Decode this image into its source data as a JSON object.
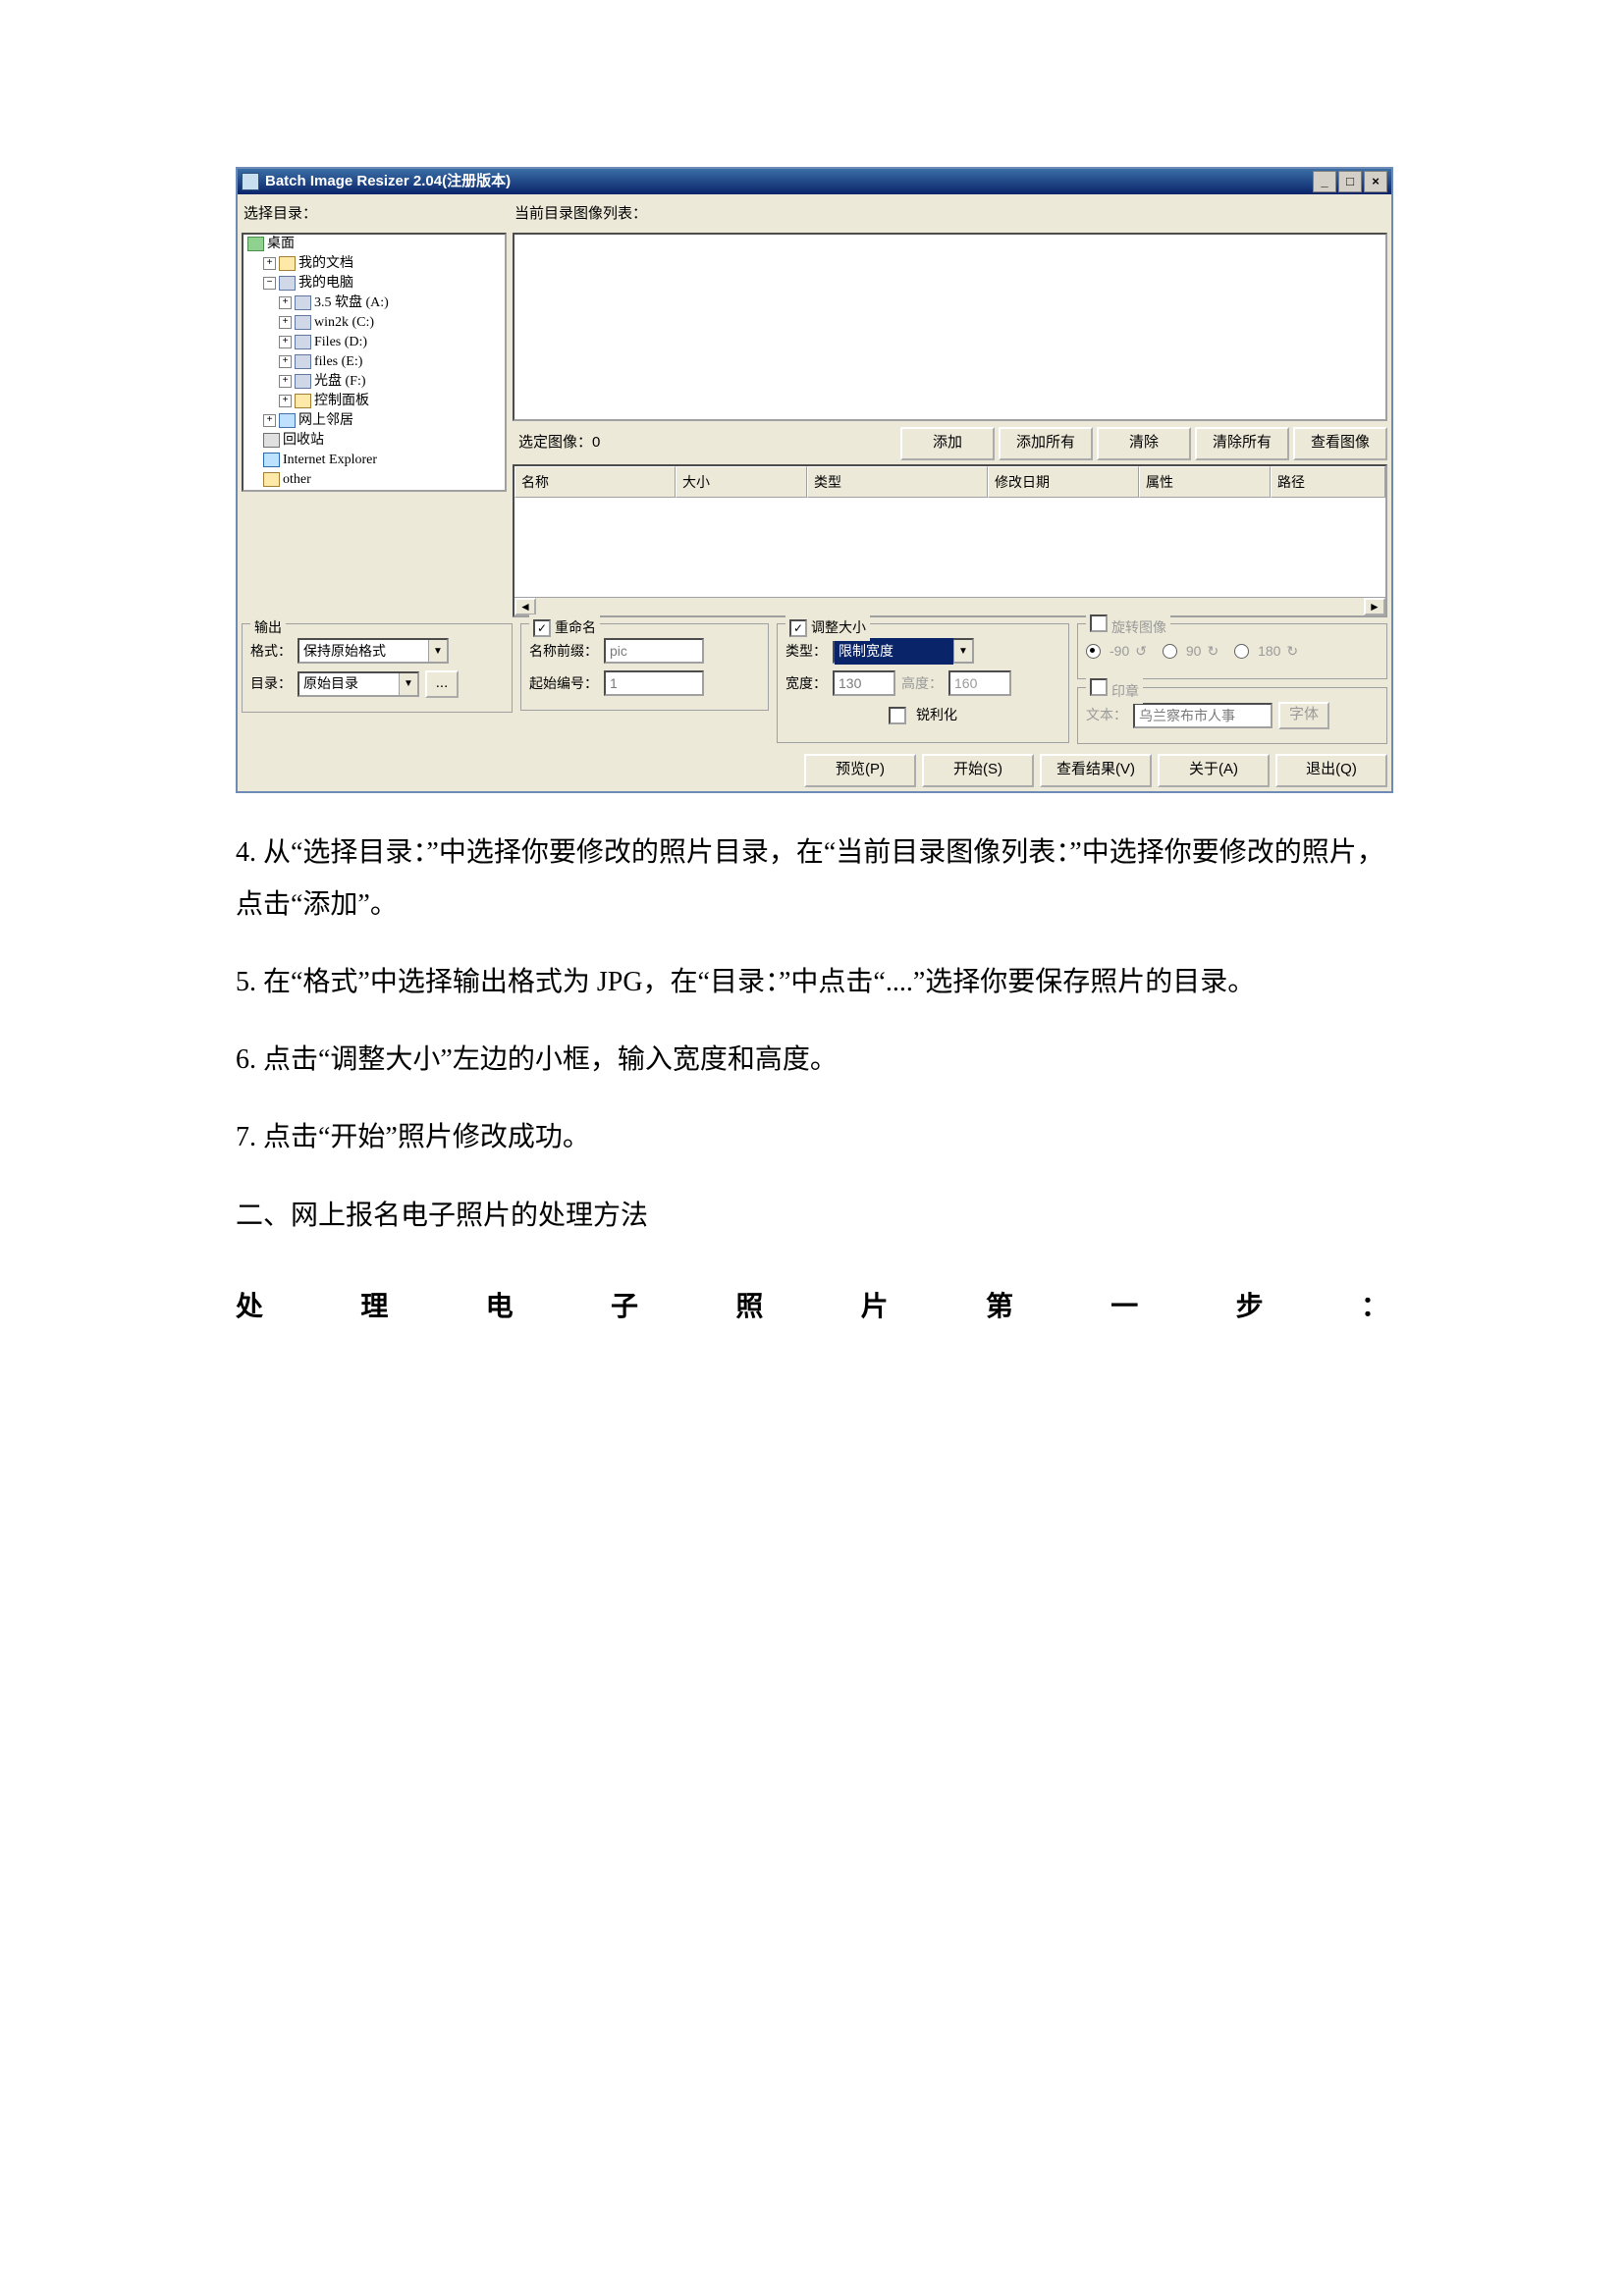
{
  "window": {
    "title": "Batch Image Resizer 2.04(注册版本)",
    "min": "_",
    "max": "□",
    "close": "×"
  },
  "labels": {
    "select_dir": "选择目录：",
    "image_list": "当前目录图像列表：",
    "selected_count": "选定图像：0"
  },
  "tree": {
    "desktop": "桌面",
    "mydocs": "我的文档",
    "mycomputer": "我的电脑",
    "a": "3.5 软盘 (A:)",
    "c": "win2k (C:)",
    "d": "Files (D:)",
    "e": "files (E:)",
    "f": "光盘 (F:)",
    "ctrl": "控制面板",
    "net": "网上邻居",
    "bin": "回收站",
    "ie": "Internet Explorer",
    "other": "other"
  },
  "buttons": {
    "add": "添加",
    "add_all": "添加所有",
    "remove": "清除",
    "remove_all": "清除所有",
    "view": "查看图像",
    "preview": "预览(P)",
    "start": "开始(S)",
    "results": "查看结果(V)",
    "about": "关于(A)",
    "quit": "退出(Q)",
    "browse": "...",
    "font": "字体"
  },
  "columns": {
    "name": "名称",
    "size": "大小",
    "type": "类型",
    "date": "修改日期",
    "attr": "属性",
    "path": "路径"
  },
  "output": {
    "group": "输出",
    "format_label": "格式：",
    "format_value": "保持原始格式",
    "dir_label": "目录：",
    "dir_value": "原始目录"
  },
  "rename": {
    "chk": "重命名",
    "prefix_label": "名称前缀：",
    "prefix_value": "pic",
    "start_label": "起始编号：",
    "start_value": "1"
  },
  "resize": {
    "chk": "调整大小",
    "type_label": "类型：",
    "type_value": "限制宽度",
    "w_label": "宽度：",
    "w_value": "130",
    "h_label": "高度：",
    "h_value": "160",
    "sharpen": "锐利化"
  },
  "rotate": {
    "chk": "旋转图像",
    "m90": "-90",
    "p90": "90",
    "p180": "180"
  },
  "stamp": {
    "chk": "印章",
    "text_label": "文本：",
    "text_value": "乌兰察布市人事"
  },
  "doc": {
    "p4": "4. 从“选择目录：”中选择你要修改的照片目录，在“当前目录图像列表：”中选择你要修改的照片，点击“添加”。",
    "p5": "5. 在“格式”中选择输出格式为 JPG，在“目录：”中点击“....”选择你要保存照片的目录。",
    "p6": "6. 点击“调整大小”左边的小框，输入宽度和高度。",
    "p7": "7. 点击“开始”照片修改成功。",
    "h2": "二、网上报名电子照片的处理方法",
    "spaced": [
      "处",
      "理",
      "电",
      "子",
      "照",
      "片",
      "第",
      "一",
      "步",
      "："
    ]
  }
}
